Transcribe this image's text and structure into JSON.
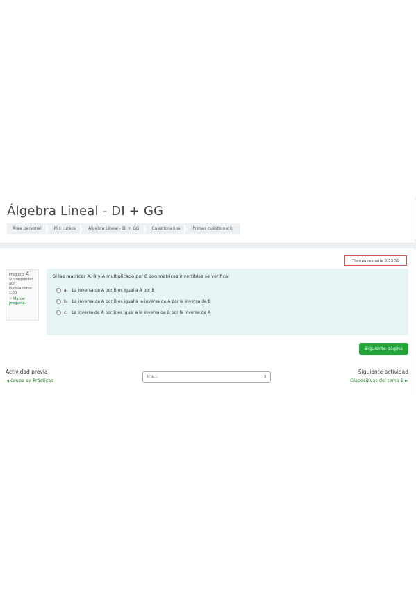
{
  "course": {
    "title": "Álgebra Lineal - DI + GG"
  },
  "breadcrumb": [
    "Área personal",
    "Mis cursos",
    "Álgebra Lineal - DI + GG",
    "Cuestionarios",
    "Primer cuestionario"
  ],
  "timer": {
    "label": "Tiempo restante 0:53:50"
  },
  "question_info": {
    "prefix": "Pregunta",
    "number": "4",
    "status": "Sin responder aún",
    "points": "Puntúa como 1,00",
    "flag": "Marcar pregunta",
    "flag_icon": "flag-icon"
  },
  "question": {
    "text": "Si las matrices A, B y A multiplicado por B son matrices invertibles se verifica:",
    "options": [
      {
        "letter": "a.",
        "text": "La inversa de A por B es igual a A por B"
      },
      {
        "letter": "b.",
        "text": "La inversa de A por B es igual a la inversa de A por la inversa de B"
      },
      {
        "letter": "c.",
        "text": "La inversa de A por B es igual a la inversa de B por la inversa de A"
      }
    ]
  },
  "buttons": {
    "next_page": "Siguiente página"
  },
  "nav": {
    "prev_label": "Actividad previa",
    "prev_link": "◄ Grupo de Prácticas",
    "jump_placeholder": "Ir a...",
    "jump_arrow": "⬍",
    "next_label": "Siguiente actividad",
    "next_link": "Diapositivas del tema 1 ►"
  },
  "colors": {
    "accent": "#22a639",
    "link": "#1c7c23",
    "question_bg": "#e6f4f6",
    "timer_border": "#d9534f"
  }
}
